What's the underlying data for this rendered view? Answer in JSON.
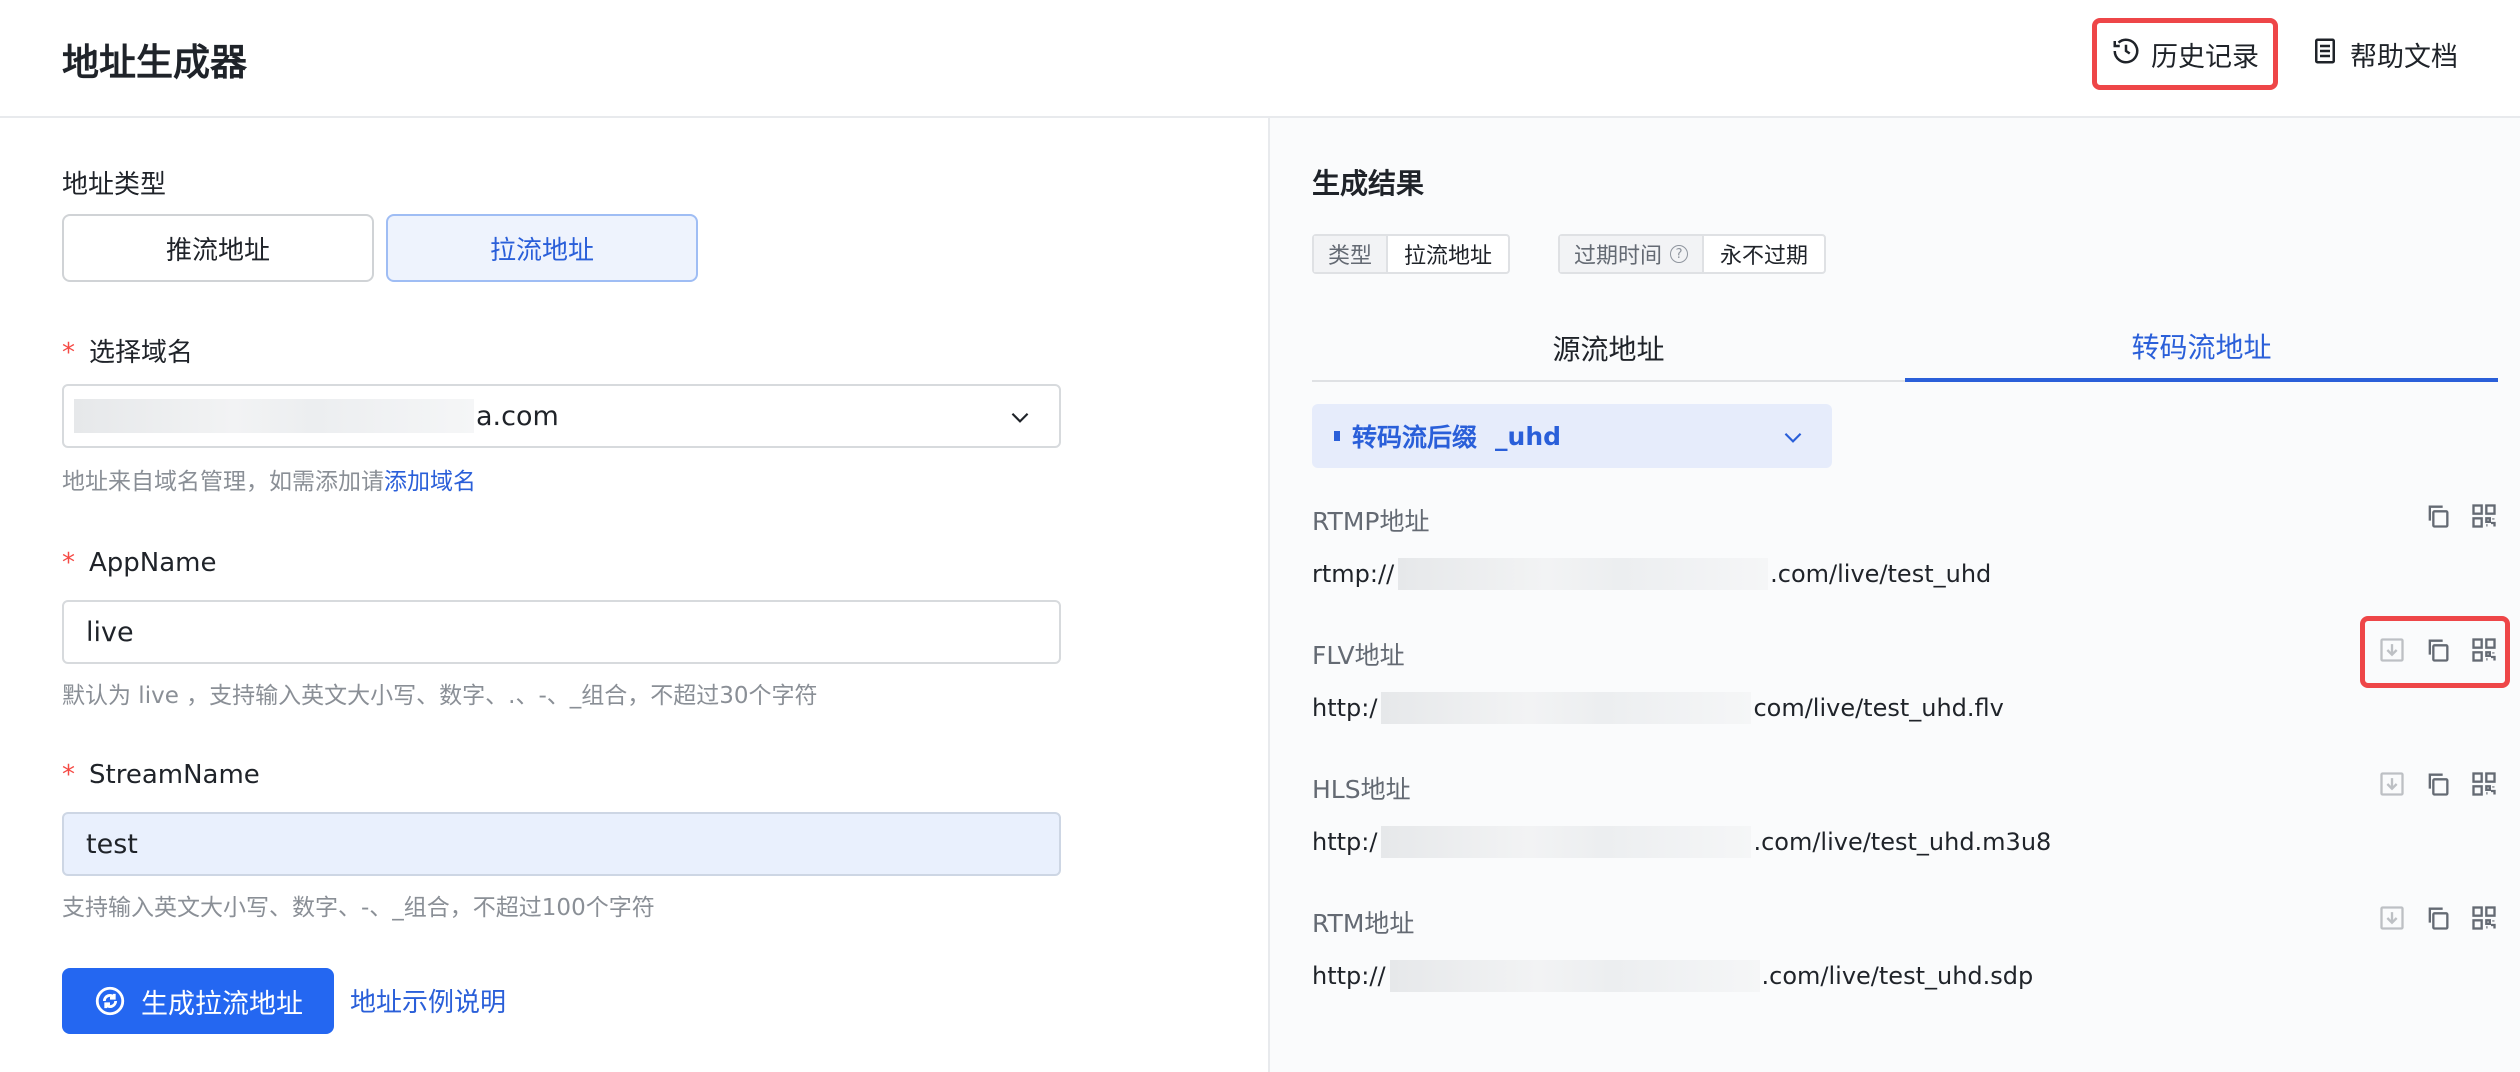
{
  "header": {
    "title": "地址生成器",
    "history_label": "历史记录",
    "help_label": "帮助文档"
  },
  "form": {
    "addr_type_label": "地址类型",
    "addr_type_options": [
      "推流地址",
      "拉流地址"
    ],
    "addr_type_selected": "拉流地址",
    "domain_label": "选择域名",
    "domain_value_suffix": "a.com",
    "domain_hint": "地址来自域名管理，如需添加请",
    "domain_hint_link": "添加域名",
    "appname_label": "AppName",
    "appname_value": "live",
    "appname_hint": "默认为 live ，支持输入英文大小写、数字、.、-、_组合，不超过30个字符",
    "stream_label": "StreamName",
    "stream_value": "test",
    "stream_hint": "支持输入英文大小写、数字、-、_组合，不超过100个字符",
    "generate_button": "生成拉流地址",
    "example_link": "地址示例说明"
  },
  "result": {
    "title": "生成结果",
    "type_key": "类型",
    "type_value": "拉流地址",
    "expire_key": "过期时间",
    "expire_value": "永不过期",
    "tabs": [
      "源流地址",
      "转码流地址"
    ],
    "active_tab": "转码流地址",
    "suffix_label": "转码流后缀",
    "suffix_value": "_uhd",
    "addresses": [
      {
        "label": "RTMP地址",
        "prefix": "rtmp://",
        "suffix": ".com/live/test_uhd"
      },
      {
        "label": "FLV地址",
        "prefix": "http:/",
        "suffix": "com/live/test_uhd.flv"
      },
      {
        "label": "HLS地址",
        "prefix": "http:/",
        "suffix": ".com/live/test_uhd.m3u8"
      },
      {
        "label": "RTM地址",
        "prefix": "http://",
        "suffix": ".com/live/test_uhd.sdp"
      }
    ]
  },
  "icons": {
    "history": "history-clock-icon",
    "help": "document-icon",
    "download": "download-icon",
    "copy": "copy-icon",
    "qrcode": "qrcode-icon",
    "chevron": "chevron-down-icon",
    "refresh": "refresh-icon",
    "help_circle": "question-circle-icon"
  },
  "colors": {
    "primary": "#2467f1",
    "link": "#2a5fd9",
    "highlight": "#ee4648",
    "required": "#f54a45"
  }
}
